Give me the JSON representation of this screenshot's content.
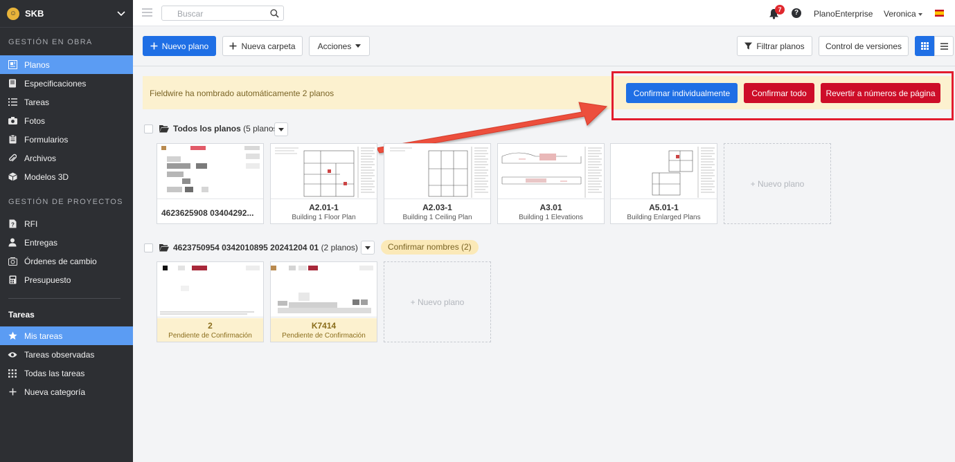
{
  "brand": {
    "name": "SKB"
  },
  "sidebar": {
    "section_obra": "GESTIÓN EN OBRA",
    "obra_items": [
      {
        "label": "Planos",
        "icon": "blueprint-icon"
      },
      {
        "label": "Especificaciones",
        "icon": "book-icon"
      },
      {
        "label": "Tareas",
        "icon": "list-icon"
      },
      {
        "label": "Fotos",
        "icon": "camera-icon"
      },
      {
        "label": "Formularios",
        "icon": "clipboard-icon"
      },
      {
        "label": "Archivos",
        "icon": "paperclip-icon"
      },
      {
        "label": "Modelos 3D",
        "icon": "cube-icon"
      }
    ],
    "section_proyectos": "GESTIÓN DE PROYECTOS",
    "proyecto_items": [
      {
        "label": "RFI",
        "icon": "document-question-icon"
      },
      {
        "label": "Entregas",
        "icon": "person-icon"
      },
      {
        "label": "Órdenes de cambio",
        "icon": "change-order-icon"
      },
      {
        "label": "Presupuesto",
        "icon": "calculator-icon"
      }
    ],
    "tasks_title": "Tareas",
    "task_items": [
      {
        "label": "Mis tareas",
        "icon": "star-icon"
      },
      {
        "label": "Tareas observadas",
        "icon": "eye-icon"
      },
      {
        "label": "Todas las tareas",
        "icon": "grid-dots-icon"
      },
      {
        "label": "Nueva categoría",
        "icon": "plus-icon"
      }
    ]
  },
  "topbar": {
    "search_placeholder": "Buscar",
    "notifications_count": "7",
    "help": "?",
    "org": "PlanoEnterprise",
    "user": "Veronica"
  },
  "toolbar": {
    "new_plan": "Nuevo plano",
    "new_folder": "Nueva carpeta",
    "actions": "Acciones",
    "filter": "Filtrar planos",
    "versions": "Control de versiones"
  },
  "banner": {
    "text": "Fieldwire ha nombrado automáticamente 2 planos",
    "confirm_individual": "Confirmar individualmente",
    "confirm_all": "Confirmar todo",
    "revert": "Revertir a números de página"
  },
  "groups": [
    {
      "title": "Todos los planos",
      "count": "(5 planos)",
      "cards": [
        {
          "title": "4623625908 03404292...",
          "subtitle": ""
        },
        {
          "title": "A2.01-1",
          "subtitle": "Building 1 Floor Plan"
        },
        {
          "title": "A2.03-1",
          "subtitle": "Building 1 Ceiling Plan"
        },
        {
          "title": "A3.01",
          "subtitle": "Building 1 Elevations"
        },
        {
          "title": "A5.01-1",
          "subtitle": "Building Enlarged Plans"
        }
      ],
      "new_card": "+ Nuevo plano"
    },
    {
      "title": "4623750954 0342010895 20241204 01",
      "count": "(2 planos)",
      "confirm_names": "Confirmar nombres (2)",
      "cards": [
        {
          "title": "2",
          "subtitle": "Pendiente de Confirmación"
        },
        {
          "title": "K7414",
          "subtitle": "Pendiente de Confirmación"
        }
      ],
      "new_card": "+ Nuevo plano"
    }
  ],
  "colors": {
    "primary": "#1f6fe5",
    "danger": "#cd0d28",
    "sidebar_bg": "#2d2f33",
    "sidebar_active": "#5b9cf3",
    "banner_bg": "#fcf1cf",
    "highlight": "#e21c2e"
  }
}
